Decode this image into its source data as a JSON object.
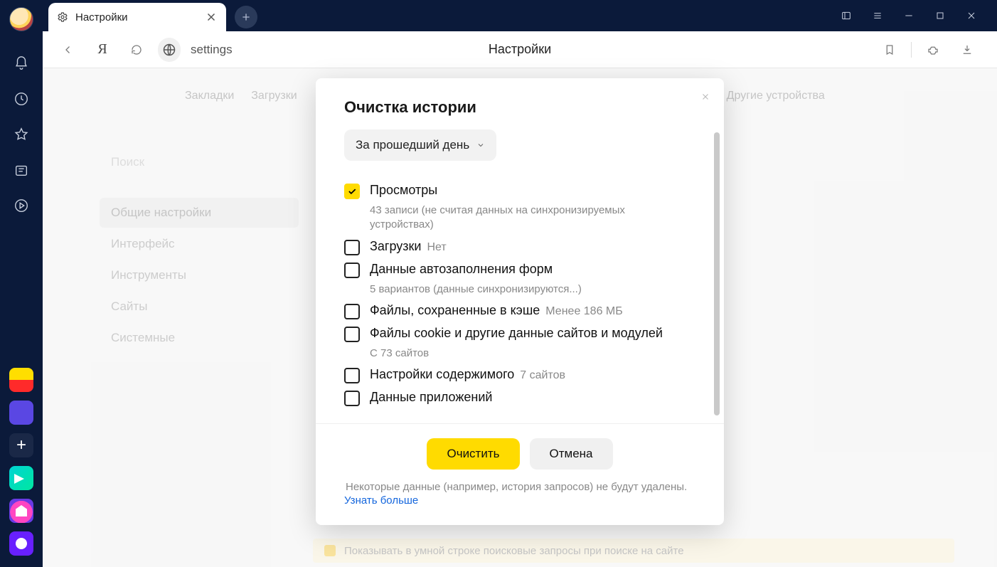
{
  "tab": {
    "title": "Настройки"
  },
  "toolbar": {
    "address": "settings",
    "title": "Настройки"
  },
  "nav": [
    "Закладки",
    "Загрузки",
    "Другие устройства"
  ],
  "search_placeholder": "Поиск",
  "sidebar": {
    "items": [
      {
        "label": "Общие настройки",
        "active": true
      },
      {
        "label": "Интерфейс",
        "active": false
      },
      {
        "label": "Инструменты",
        "active": false
      },
      {
        "label": "Сайты",
        "active": false
      },
      {
        "label": "Системные",
        "active": false
      }
    ]
  },
  "modal": {
    "title": "Очистка истории",
    "range": "За прошедший день",
    "options": [
      {
        "id": "views",
        "label": "Просмотры",
        "sub": "43 записи (не считая данных на синхронизируемых устройствах)",
        "checked": true
      },
      {
        "id": "downloads",
        "label": "Загрузки",
        "side": "Нет",
        "checked": false
      },
      {
        "id": "autofill",
        "label": "Данные автозаполнения форм",
        "sub": "5 вариантов (данные синхронизируются...)",
        "checked": false
      },
      {
        "id": "cache",
        "label": "Файлы, сохраненные в кэше",
        "side": "Менее 186 МБ",
        "checked": false
      },
      {
        "id": "cookies",
        "label": "Файлы cookie и другие данные сайтов и модулей",
        "sub": "С 73 сайтов",
        "checked": false
      },
      {
        "id": "content",
        "label": "Настройки содержимого",
        "side": "7 сайтов",
        "checked": false
      },
      {
        "id": "apps",
        "label": "Данные приложений",
        "checked": false
      }
    ],
    "clear": "Очистить",
    "cancel": "Отмена",
    "footnote": "Некоторые данные (например, история запросов) не будут удалены.",
    "learn_more": "Узнать больше"
  },
  "bottom_hint": "Показывать в умной строке поисковые запросы при поиске на сайте"
}
